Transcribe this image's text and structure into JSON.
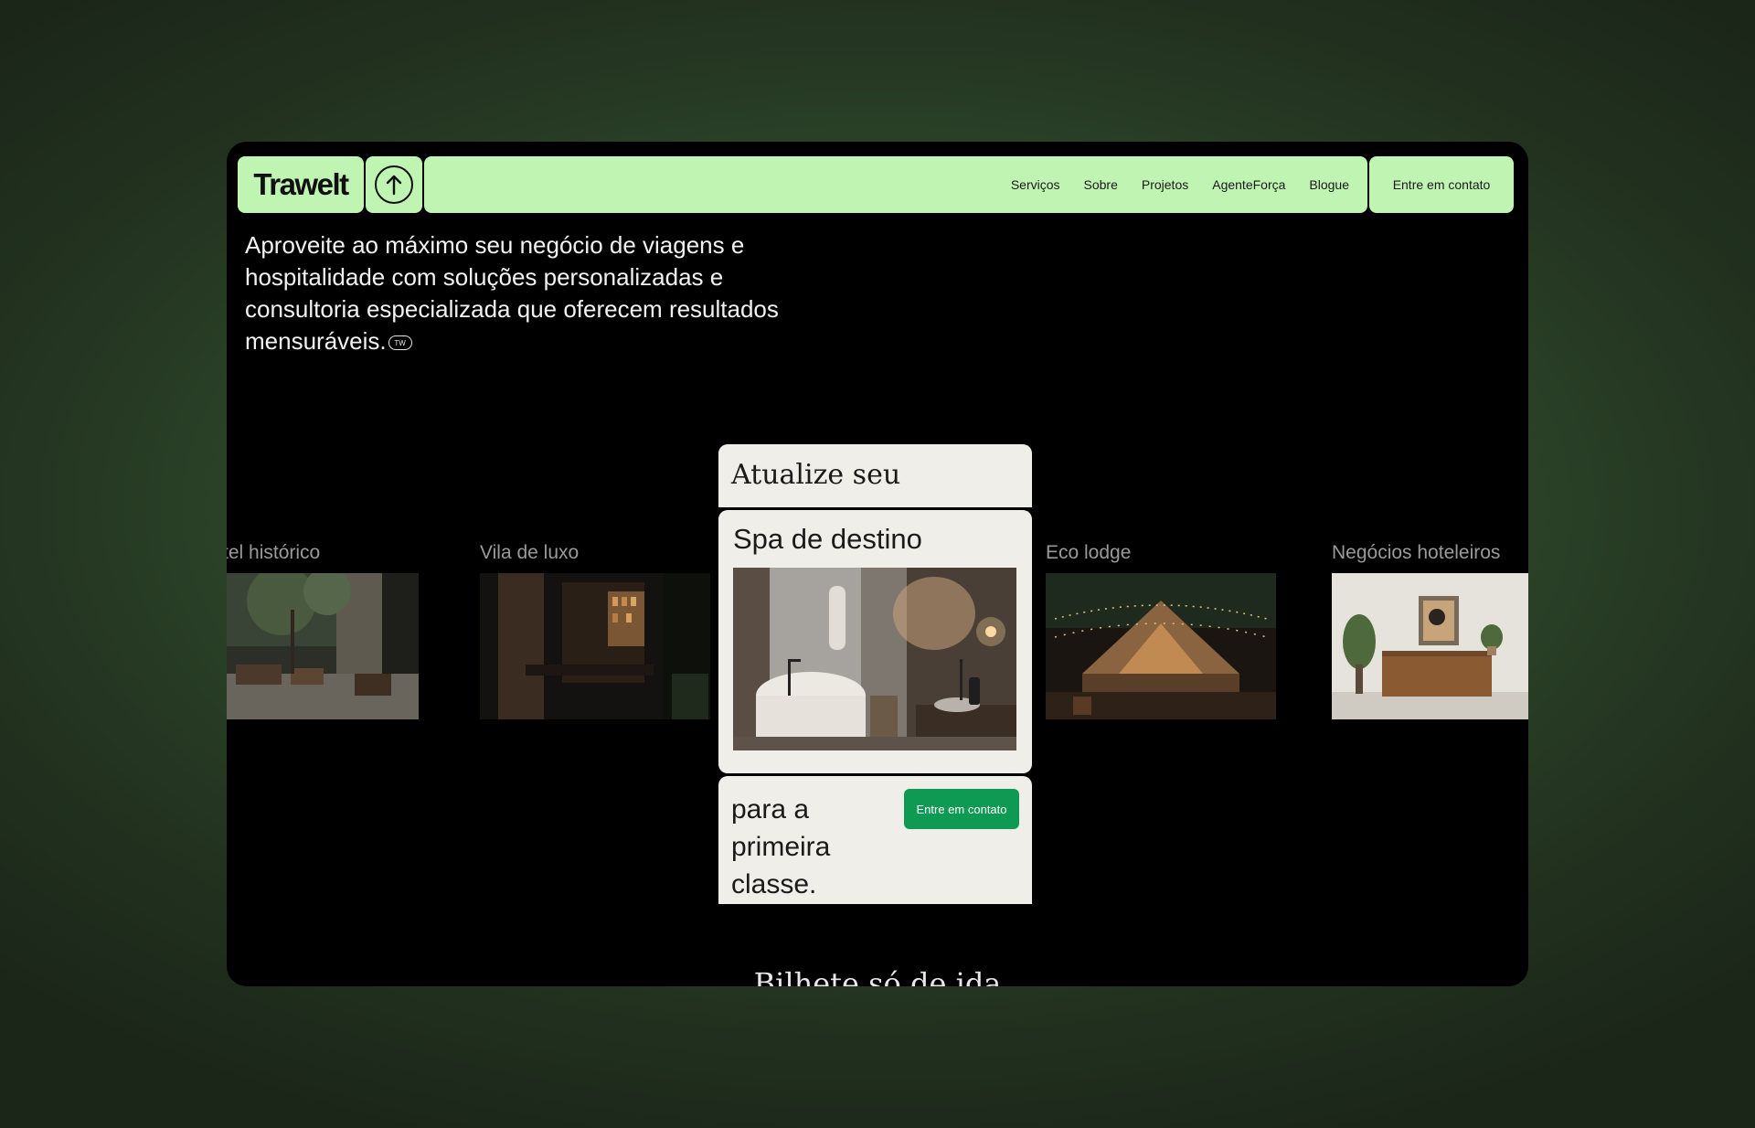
{
  "brand": {
    "name": "Trawelt"
  },
  "nav": {
    "items": [
      {
        "label": "Serviços"
      },
      {
        "label": "Sobre"
      },
      {
        "label": "Projetos"
      },
      {
        "label": "AgenteForça"
      },
      {
        "label": "Blogue"
      }
    ],
    "contact_label": "Entre em contato"
  },
  "hero": {
    "intro": "Aproveite ao máximo seu negócio de viagens e hospitalidade com soluções personalizadas e consultoria especializada que oferecem resultados mensuráveis.",
    "badge": "TW"
  },
  "cards": [
    {
      "label": "tel histórico"
    },
    {
      "label": "Vila de luxo"
    },
    {
      "label": "Eco lodge"
    },
    {
      "label": "Negócios hoteleiros"
    }
  ],
  "center": {
    "top": "Atualize seu",
    "middle": "Spa de destino",
    "bottom": "para a primeira classe.",
    "cta": "Entre em contato"
  },
  "footer": {
    "partial_heading": "Bilhete só de ida"
  },
  "colors": {
    "nav_bg": "#bff4b2",
    "cta_green": "#0f9a53",
    "card_bg": "#f0eee9"
  }
}
